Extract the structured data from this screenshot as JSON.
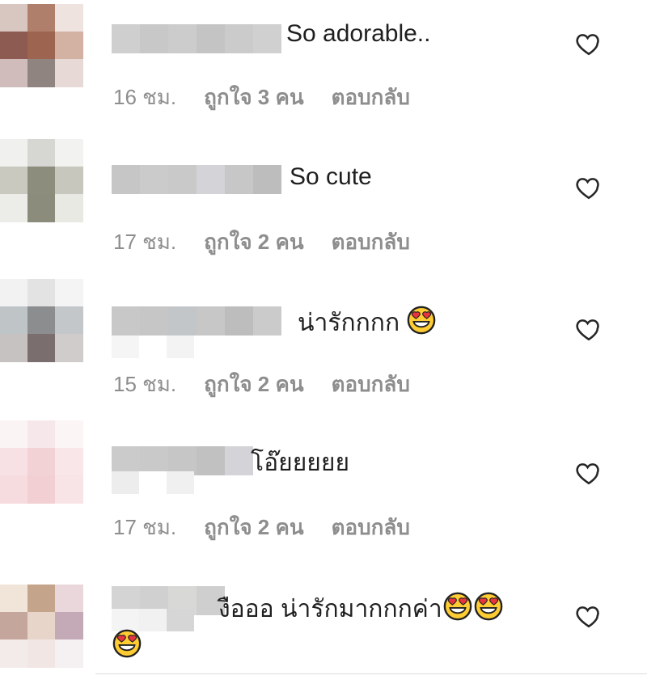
{
  "comments": [
    {
      "text": "So adorable..",
      "time": "16 ชม.",
      "likes": "ถูกใจ 3 คน",
      "reply": "ตอบกลับ",
      "emojis": 0,
      "avatar_colors": [
        "#d8c7c1",
        "#b07f6c",
        "#efe3df",
        "#8e5b53",
        "#9d6550",
        "#d3b2a4",
        "#cfbcbb",
        "#8f8480",
        "#e7dad6"
      ],
      "name_colors": [
        "#cfcfcf",
        "#c8c8c8",
        "#cccccc",
        "#c4c4c4",
        "#cbcbcb",
        "#d0d0d0"
      ]
    },
    {
      "text": "So cute",
      "time": "17 ชม.",
      "likes": "ถูกใจ 2 คน",
      "reply": "ตอบกลับ",
      "emojis": 0,
      "avatar_colors": [
        "#f0f0ee",
        "#d6d6d2",
        "#f2f2f0",
        "#c9c9bf",
        "#8d8d7d",
        "#c7c7bd",
        "#ecece8",
        "#8c8c7c",
        "#e9e9e3"
      ],
      "name_colors": [
        "#c6c6c6",
        "#cbcbcb",
        "#c9c9c9",
        "#d3d3d8",
        "#c7c7c7",
        "#bdbdbd"
      ]
    },
    {
      "text": "น่ารักกกก",
      "time": "15 ชม.",
      "likes": "ถูกใจ 2 คน",
      "reply": "ตอบกลับ",
      "emojis": 1,
      "avatar_colors": [
        "#f2f2f2",
        "#e3e3e3",
        "#f4f4f4",
        "#bfc4c7",
        "#8b8d8e",
        "#c4c7c9",
        "#c7c2c2",
        "#7b6e6e",
        "#d1cccc"
      ],
      "name_colors": [
        "#c8c8c8",
        "#c6c6c6",
        "#c3c6c8",
        "#c7c7c7",
        "#bdbdbd",
        "#cbcbcb"
      ]
    },
    {
      "text": "โอ๊ยยยยย",
      "time": "17 ชม.",
      "likes": "ถูกใจ 2 คน",
      "reply": "ตอบกลับ",
      "emojis": 0,
      "avatar_colors": [
        "#fbf4f5",
        "#f6e8ea",
        "#fbf5f6",
        "#f7e1e4",
        "#f3d2d6",
        "#f8e6e8",
        "#f6dcdf",
        "#f2cfd3",
        "#f8e3e6"
      ],
      "name_colors": [
        "#cbcbcb",
        "#c9c9c9",
        "#c6c6c6",
        "#c1c1c1",
        "#d4d4d8"
      ]
    },
    {
      "text": "งือออ น่ารักมากกกค่า",
      "time": "",
      "likes": "",
      "reply": "",
      "emojis": 3,
      "avatar_colors": [
        "#f1e5d9",
        "#c4a48b",
        "#ead7dc",
        "#c5a69c",
        "#e8d5ca",
        "#c4a9b7",
        "#f3ebe9",
        "#f1e6e3",
        "#f5f0f2"
      ],
      "name_colors": [
        "#d4d4d4",
        "#d0d0d0",
        "#d8d8d6",
        "#cfcfcf"
      ]
    }
  ],
  "icons": {
    "heart": "heart-outline-icon",
    "emoji": "heart-eyes-emoji"
  },
  "colors": {
    "meta": "#8e8e8e",
    "text": "#262626",
    "emoji_face": "#ffcc33",
    "emoji_heart": "#e8343f"
  }
}
